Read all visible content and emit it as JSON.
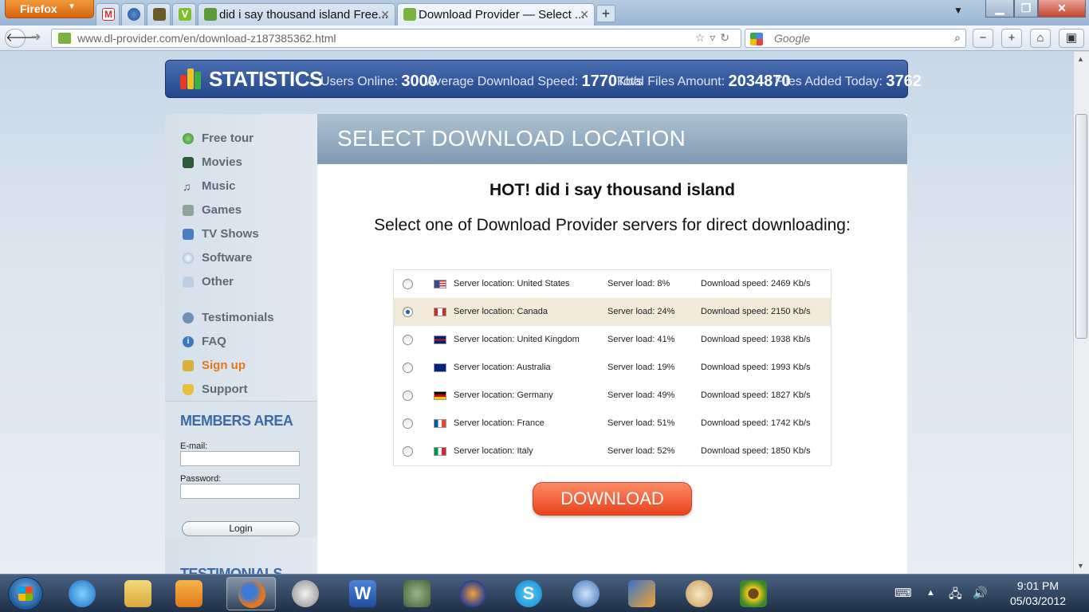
{
  "browser": {
    "menu_button": "Firefox",
    "tabs": [
      {
        "title": "did i say thousand island Free..."
      },
      {
        "title": "Download Provider — Select ..."
      }
    ],
    "url": "www.dl-provider.com/en/download-z187385362.html",
    "search_placeholder": "Google"
  },
  "stats": {
    "title": "STATISTICS",
    "users_online_label": "Users Online:",
    "users_online": "3000",
    "avg_speed_label": "Average Download Speed:",
    "avg_speed": "1770",
    "avg_speed_unit": "Kb/s",
    "total_files_label": "Total Files Amount:",
    "total_files": "2034870",
    "files_today_label": "Files Added Today:",
    "files_today": "3762"
  },
  "sidebar": {
    "menu": [
      {
        "label": "Free tour",
        "icon": "globe-icon"
      },
      {
        "label": "Movies",
        "icon": "film-icon"
      },
      {
        "label": "Music",
        "icon": "music-note-icon"
      },
      {
        "label": "Games",
        "icon": "gamepad-icon"
      },
      {
        "label": "TV Shows",
        "icon": "tv-icon"
      },
      {
        "label": "Software",
        "icon": "disc-icon"
      },
      {
        "label": "Other",
        "icon": "documents-icon"
      }
    ],
    "menu2": [
      {
        "label": "Testimonials",
        "icon": "user-icon"
      },
      {
        "label": "FAQ",
        "icon": "info-icon"
      },
      {
        "label": "Sign up",
        "icon": "lock-icon"
      },
      {
        "label": "Support",
        "icon": "shield-icon"
      }
    ],
    "members_title": "MEMBERS AREA",
    "email_label": "E-mail:",
    "password_label": "Password:",
    "login_label": "Login",
    "testimonials_title": "TESTIMONIALS"
  },
  "main": {
    "header": "SELECT DOWNLOAD LOCATION",
    "file_title": "HOT! did i say thousand island",
    "subtitle": "Select one of Download Provider servers for direct downloading:",
    "servers": [
      {
        "location": "Server location: United States",
        "load": "Server load: 8%",
        "speed": "Download speed: 2469 Kb/s",
        "selected": false,
        "flag": "us"
      },
      {
        "location": "Server location: Canada",
        "load": "Server load: 24%",
        "speed": "Download speed: 2150 Kb/s",
        "selected": true,
        "flag": "ca"
      },
      {
        "location": "Server location: United Kingdom",
        "load": "Server load: 41%",
        "speed": "Download speed: 1938 Kb/s",
        "selected": false,
        "flag": "gb"
      },
      {
        "location": "Server location: Australia",
        "load": "Server load: 19%",
        "speed": "Download speed: 1993 Kb/s",
        "selected": false,
        "flag": "au"
      },
      {
        "location": "Server location: Germany",
        "load": "Server load: 49%",
        "speed": "Download speed: 1827 Kb/s",
        "selected": false,
        "flag": "de"
      },
      {
        "location": "Server location: France",
        "load": "Server load: 51%",
        "speed": "Download speed: 1742 Kb/s",
        "selected": false,
        "flag": "fr"
      },
      {
        "location": "Server location: Italy",
        "load": "Server load: 52%",
        "speed": "Download speed: 1850 Kb/s",
        "selected": false,
        "flag": "it"
      }
    ],
    "download_label": "DOWNLOAD"
  },
  "taskbar": {
    "time": "9:01 PM",
    "date": "05/03/2012"
  },
  "colors": {
    "accent_orange": "#e9421c",
    "stats_blue": "#25468a",
    "signup_orange": "#e07a1e",
    "selected_row": "#f1ead8"
  }
}
